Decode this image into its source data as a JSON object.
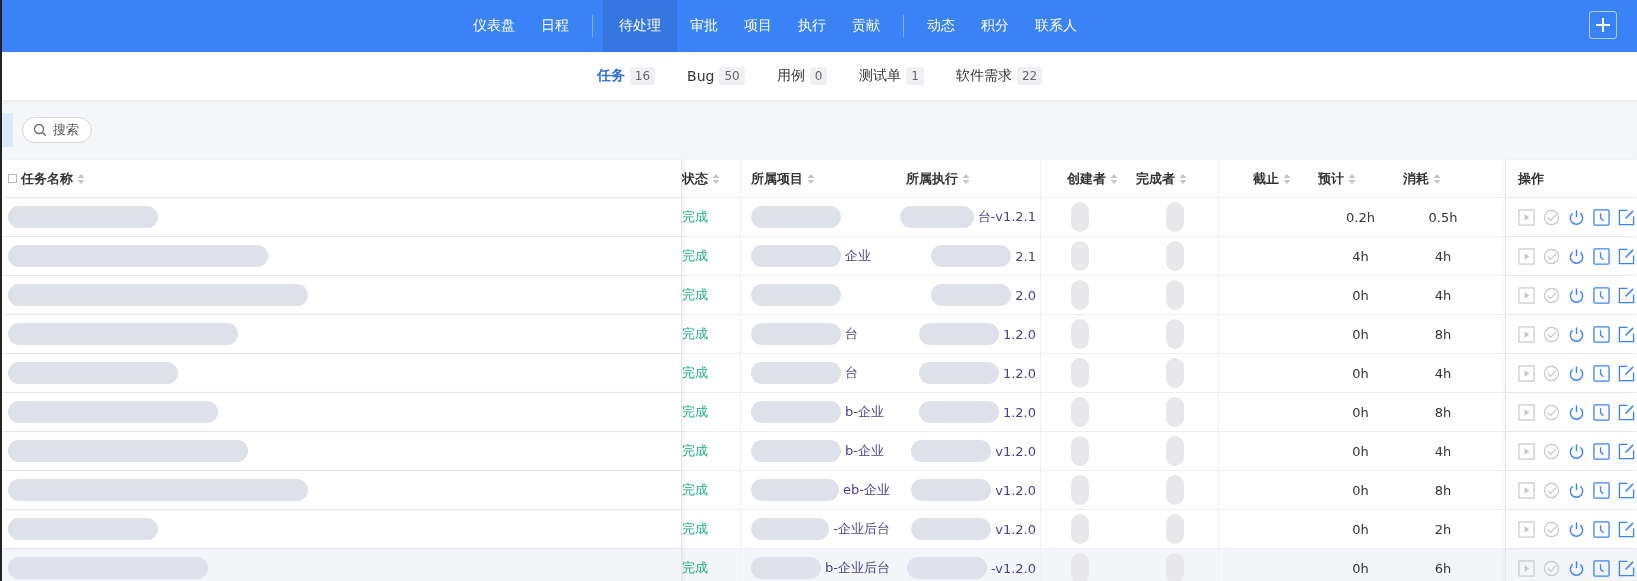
{
  "nav": {
    "groups": [
      [
        {
          "label": "仪表盘",
          "selected": false
        },
        {
          "label": "日程",
          "selected": false
        }
      ],
      [
        {
          "label": "待处理",
          "selected": true
        },
        {
          "label": "审批",
          "selected": false
        },
        {
          "label": "项目",
          "selected": false
        },
        {
          "label": "执行",
          "selected": false
        },
        {
          "label": "贡献",
          "selected": false
        }
      ],
      [
        {
          "label": "动态",
          "selected": false
        },
        {
          "label": "积分",
          "selected": false
        },
        {
          "label": "联系人",
          "selected": false
        }
      ]
    ]
  },
  "subtabs": [
    {
      "label": "任务",
      "count": "16",
      "selected": true
    },
    {
      "label": "Bug",
      "count": "50",
      "selected": false
    },
    {
      "label": "用例",
      "count": "0",
      "selected": false
    },
    {
      "label": "测试单",
      "count": "1",
      "selected": false
    },
    {
      "label": "软件需求",
      "count": "22",
      "selected": false
    }
  ],
  "search": {
    "label": "搜索"
  },
  "table": {
    "columns": [
      {
        "label": "任务名称"
      },
      {
        "label": "状态"
      },
      {
        "label": "所属项目"
      },
      {
        "label": "所属执行"
      },
      {
        "label": "创建者"
      },
      {
        "label": "完成者"
      },
      {
        "label": "截止"
      },
      {
        "label": "预计"
      },
      {
        "label": "消耗"
      }
    ],
    "action_header": "操作",
    "actions": [
      {
        "kind": "start",
        "disabled": true
      },
      {
        "kind": "finish",
        "disabled": true
      },
      {
        "kind": "close",
        "disabled": false
      },
      {
        "kind": "effort",
        "disabled": false
      },
      {
        "kind": "edit",
        "disabled": false
      }
    ],
    "rows": [
      {
        "status": "完成",
        "execution": "台-v1.2.1",
        "estimate": "0.2h",
        "consumed": "0.5h",
        "hovered": false
      },
      {
        "status": "完成",
        "project": "企业",
        "execution": "2.1",
        "estimate": "4h",
        "consumed": "4h",
        "hovered": false
      },
      {
        "status": "完成",
        "execution": "2.0",
        "estimate": "0h",
        "consumed": "4h",
        "hovered": false
      },
      {
        "status": "完成",
        "project": "台",
        "execution": "1.2.0",
        "estimate": "0h",
        "consumed": "8h",
        "hovered": false
      },
      {
        "status": "完成",
        "project": "台",
        "execution": "1.2.0",
        "estimate": "0h",
        "consumed": "4h",
        "hovered": false
      },
      {
        "status": "完成",
        "project": "b-企业",
        "execution": "1.2.0",
        "estimate": "0h",
        "consumed": "8h",
        "hovered": false
      },
      {
        "status": "完成",
        "project": "b-企业",
        "execution": "v1.2.0",
        "estimate": "0h",
        "consumed": "4h",
        "hovered": false
      },
      {
        "status": "完成",
        "project": "eb-企业",
        "execution": "v1.2.0",
        "estimate": "0h",
        "consumed": "8h",
        "hovered": false
      },
      {
        "status": "完成",
        "project": "-企业后台",
        "execution": "v1.2.0",
        "estimate": "0h",
        "consumed": "2h",
        "hovered": false
      },
      {
        "status": "完成",
        "project": "b-企业后台",
        "execution": "-v1.2.0",
        "estimate": "0h",
        "consumed": "6h",
        "hovered": true
      }
    ]
  }
}
